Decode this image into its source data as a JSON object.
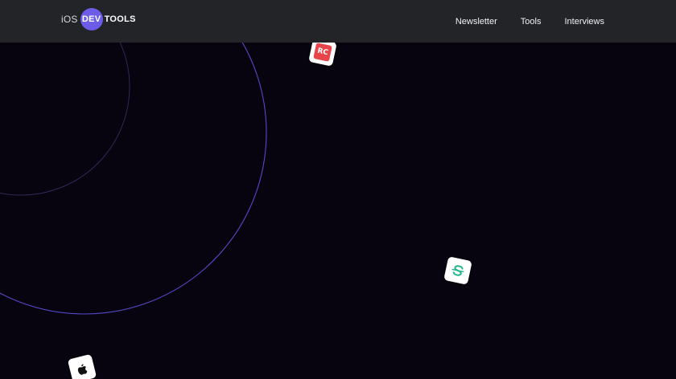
{
  "header": {
    "logo": {
      "prefix": "iOS",
      "badge": "DEV",
      "suffix": "TOOLS"
    },
    "nav": [
      {
        "label": "Newsletter"
      },
      {
        "label": "Tools"
      },
      {
        "label": "Interviews"
      }
    ]
  },
  "icons": {
    "rc": {
      "name": "rc-logo-icon",
      "text": "RC"
    },
    "s": {
      "name": "s-logo-icon"
    },
    "apple": {
      "name": "apple-icon"
    }
  },
  "colors": {
    "background": "#07040f",
    "header": "#232427",
    "accent": "#6c5ce7",
    "ring_outer": "#5549c9",
    "ring_inner": "#2e2a5a",
    "rc_red": "#e8454a",
    "s_green": "#1fb58a"
  }
}
